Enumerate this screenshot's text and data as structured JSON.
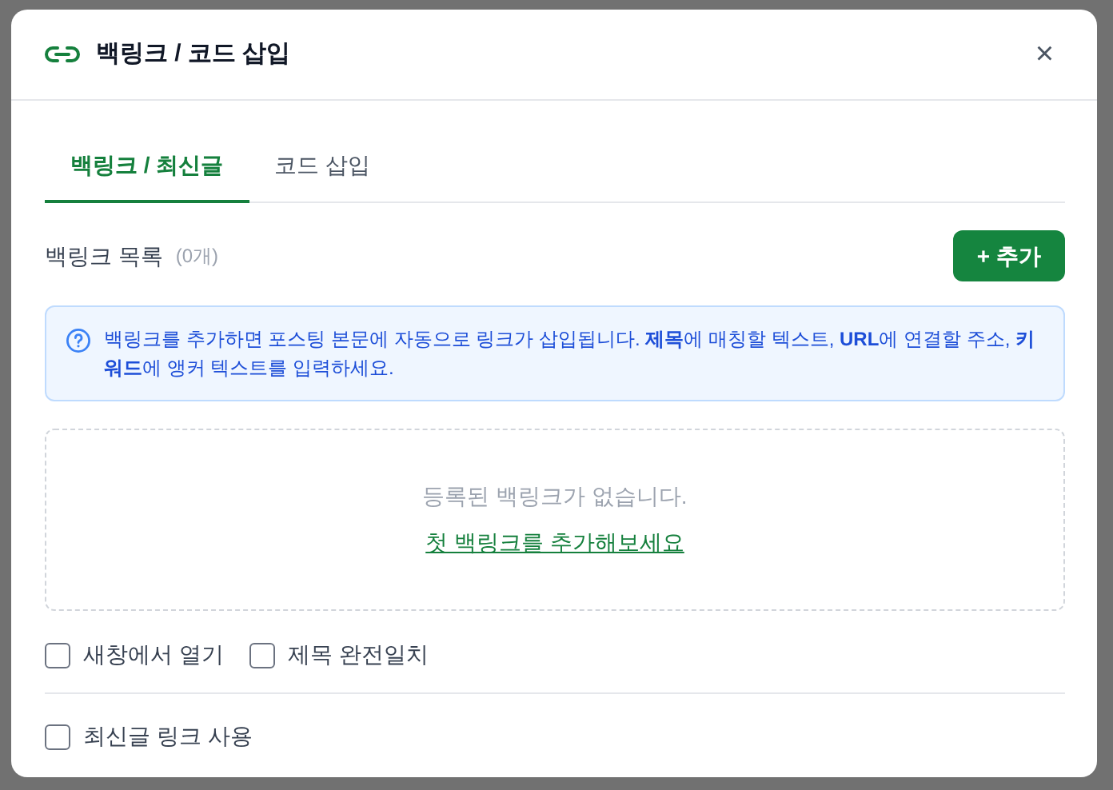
{
  "dialog": {
    "title": "백링크 / 코드 삽입",
    "close": "×"
  },
  "tabs": [
    {
      "label": "백링크 / 최신글",
      "selected": true
    },
    {
      "label": "코드 삽입",
      "selected": false
    }
  ],
  "list_header": {
    "label": "백링크 목록",
    "count": "(0개)",
    "add_button": "+ 추가"
  },
  "info": "백링크를 추가하면 포스팅 본문에 자동으로 링크가 삽입됩니다. **제목**에 매칭할 텍스트, **URL**에 연결할 주소, **키워드**에 앵커 텍스트를 입력하세요.",
  "empty_state": {
    "message": "등록된 백링크가 없습니다.",
    "link": "첫 백링크를 추가해보세요"
  },
  "options": [
    {
      "label": "새창에서 열기",
      "checked": false
    },
    {
      "label": "제목 완전일치",
      "checked": false
    }
  ],
  "latest_option": {
    "label": "최신글 링크 사용",
    "checked": false
  }
}
